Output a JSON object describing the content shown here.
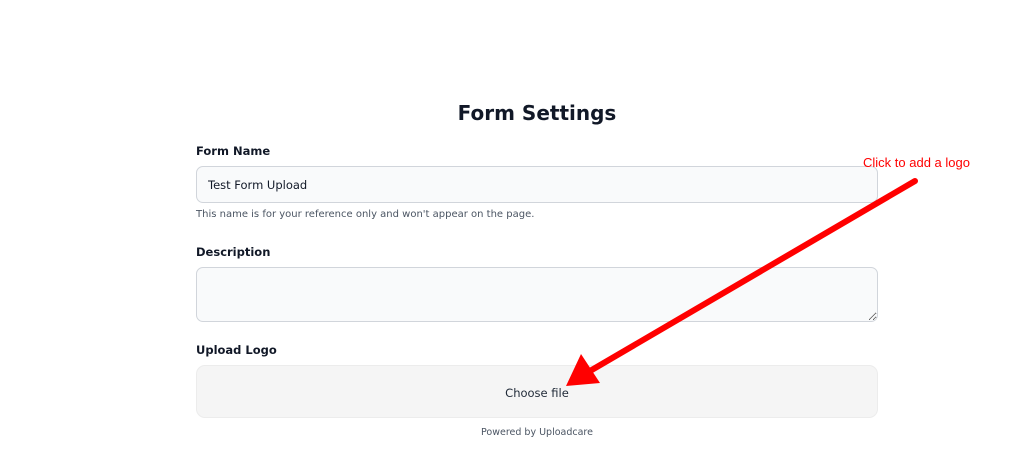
{
  "form": {
    "title": "Form Settings",
    "name_label": "Form Name",
    "name_value": "Test Form Upload",
    "name_help": "This name is for your reference only and won't appear on the page.",
    "description_label": "Description",
    "description_value": "",
    "logo_label": "Upload Logo",
    "choose_file_label": "Choose file",
    "powered_by": "Powered by Uploadcare"
  },
  "annotation": {
    "text": "Click to add a logo",
    "color": "#ff0000"
  }
}
